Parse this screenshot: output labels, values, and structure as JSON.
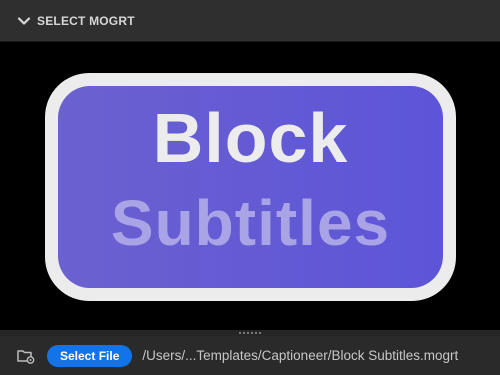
{
  "header": {
    "title": "SELECT MOGRT",
    "icon": "chevron-down-icon"
  },
  "preview": {
    "line1": "Block",
    "line2": "Subtitles",
    "colors": {
      "pill_border": "#ececec",
      "pill_fill": "#5f56d6",
      "line1": "#ececec",
      "line2": "#a9a4e6"
    }
  },
  "footer": {
    "file_icon": "folder-settings-icon",
    "select_label": "Select File",
    "path": "/Users/...Templates/Captioneer/Block Subtitles.mogrt",
    "accent": "#1473e6"
  }
}
